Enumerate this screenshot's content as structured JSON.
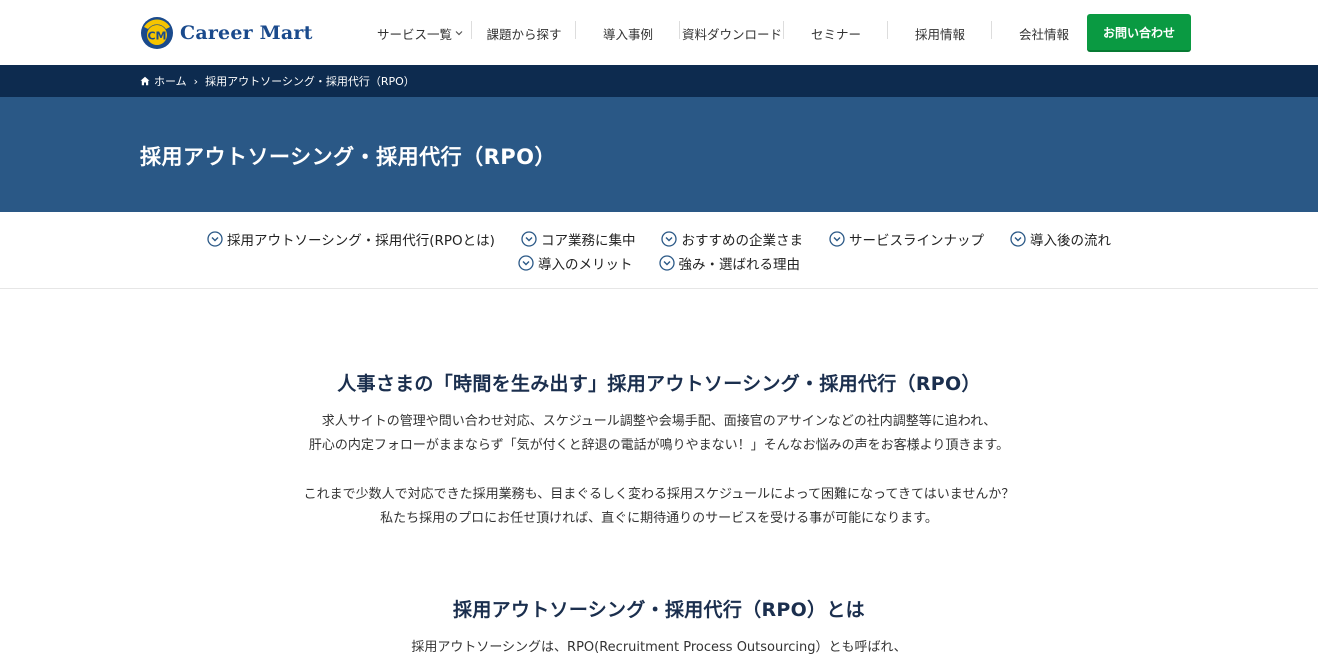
{
  "header": {
    "logo_text": "Career Mart",
    "nav": [
      {
        "label": "サービス一覧",
        "has_dropdown": true
      },
      {
        "label": "課題から探す"
      },
      {
        "label": "導入事例"
      },
      {
        "label": "資料ダウンロード"
      },
      {
        "label": "セミナー"
      },
      {
        "label": "採用情報"
      },
      {
        "label": "会社情報"
      }
    ],
    "contact_label": "お問い合わせ"
  },
  "breadcrumb": {
    "home": "ホーム",
    "separator": "›",
    "current": "採用アウトソーシング・採用代行（RPO）"
  },
  "page_title": "採用アウトソーシング・採用代行（RPO）",
  "anchor_nav": {
    "row1": [
      "採用アウトソーシング・採用代行(RPOとは)",
      "コア業務に集中",
      "おすすめの企業さま",
      "サービスラインナップ",
      "導入後の流れ"
    ],
    "row2": [
      "導入のメリット",
      "強み・選ばれる理由"
    ]
  },
  "main": {
    "section1_title": "人事さまの「時間を生み出す」採用アウトソーシング・採用代行（RPO）",
    "para1": [
      "求人サイトの管理や問い合わせ対応、スケジュール調整や会場手配、面接官のアサインなどの社内調整等に追われ、",
      "肝心の内定フォローがままならず「気が付くと辞退の電話が鳴りやまない！」そんなお悩みの声をお客様より頂きます。"
    ],
    "para2": [
      "これまで少数人で対応できた採用業務も、目まぐるしく変わる採用スケジュールによって困難になってきてはいませんか？",
      "私たち採用のプロにお任せ頂ければ、直ぐに期待通りのサービスを受ける事が可能になります。"
    ],
    "section2_title": "採用アウトソーシング・採用代行（RPO）とは",
    "para3": [
      "採用アウトソーシングは、RPO(Recruitment Process Outsourcing）とも呼ばれ、"
    ]
  },
  "colors": {
    "breadcrumb_bg": "#0d2b4f",
    "title_band_bg": "#2a5886",
    "contact_button": "#0a9a42",
    "logo_blue": "#1a4a8c",
    "logo_yellow": "#f5c400",
    "heading_navy": "#1b2f4e"
  },
  "icons": {
    "logo": "career-mart-logo",
    "home": "home-icon",
    "anchor": "chevron-circle-down-icon",
    "dropdown": "chevron-down-icon"
  }
}
